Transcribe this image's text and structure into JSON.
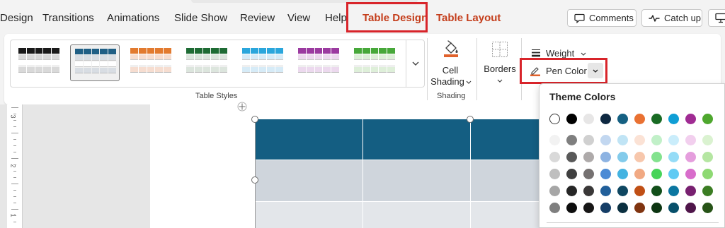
{
  "tabs": [
    {
      "label": "Design",
      "name": "tab-design"
    },
    {
      "label": "Transitions",
      "name": "tab-transitions"
    },
    {
      "label": "Animations",
      "name": "tab-animations"
    },
    {
      "label": "Slide Show",
      "name": "tab-slide-show"
    },
    {
      "label": "Review",
      "name": "tab-review"
    },
    {
      "label": "View",
      "name": "tab-view"
    },
    {
      "label": "Help",
      "name": "tab-help"
    },
    {
      "label": "Table Design",
      "name": "tab-table-design"
    },
    {
      "label": "Table Layout",
      "name": "tab-table-layout"
    }
  ],
  "toolbar": {
    "comments_label": "Comments",
    "catch_up_label": "Catch up"
  },
  "ribbon": {
    "table_styles_label": "Table Styles",
    "cell_shading_line1": "Cell",
    "cell_shading_line2": "Shading",
    "shading_group_label": "Shading",
    "borders_label": "Borders",
    "weight_label": "Weight",
    "pen_color_label": "Pen Color",
    "styles": [
      {
        "header": "#1a1a1a",
        "body": "#d9d9d9"
      },
      {
        "header": "#1f5f85",
        "body": "#d8dde3"
      },
      {
        "header": "#e27a2f",
        "body": "#f6ddd0"
      },
      {
        "header": "#1e6b34",
        "body": "#dce5dd"
      },
      {
        "header": "#2aa6dc",
        "body": "#d6ebf7"
      },
      {
        "header": "#9b3aa0",
        "body": "#ecd9ee"
      },
      {
        "header": "#47a83a",
        "body": "#deefd9"
      }
    ]
  },
  "table": {
    "header_color": "#145e82",
    "row_colors": [
      "#cfd5dc",
      "#e3e6ea"
    ]
  },
  "panel": {
    "title": "Theme Colors",
    "swatches": [
      [
        "#ffffff",
        "#000000",
        "#e7e6e6",
        "#0e2841",
        "#156082",
        "#e97132",
        "#196b24",
        "#0f9ed5",
        "#a02b93",
        "#4ea72e"
      ],
      [
        "#f2f2f2",
        "#7f7f7f",
        "#d0d0d0",
        "#c2d7f0",
        "#c0e4f5",
        "#fbe2d5",
        "#c1f0c8",
        "#caedfb",
        "#f2cfee",
        "#daf2d0"
      ],
      [
        "#d9d9d9",
        "#595959",
        "#aeaaaa",
        "#8db3e2",
        "#83cbeb",
        "#f7c7ac",
        "#83e28e",
        "#95dcf7",
        "#e59edd",
        "#b5e6a2"
      ],
      [
        "#bfbfbf",
        "#404040",
        "#757171",
        "#4c8bd5",
        "#44b3e1",
        "#f1a983",
        "#47d459",
        "#60caf3",
        "#d86dcb",
        "#8ed973"
      ],
      [
        "#a6a6a6",
        "#262626",
        "#3a3838",
        "#215f9a",
        "#0f4761",
        "#c04f15",
        "#124f1a",
        "#0b76a0",
        "#782070",
        "#3b7d23"
      ],
      [
        "#7f7f7f",
        "#0d0d0d",
        "#171616",
        "#153d66",
        "#0a2f40",
        "#803410",
        "#0c3511",
        "#074f6a",
        "#4f154a",
        "#275317"
      ]
    ]
  },
  "ruler": {
    "numbers": [
      "3",
      "2",
      "1"
    ]
  }
}
